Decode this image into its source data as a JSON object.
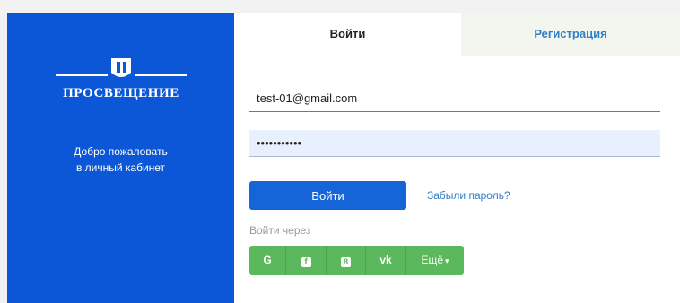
{
  "brand": {
    "name": "ПРОСВЕЩЕНИЕ",
    "accent": "#0b57d8"
  },
  "welcome": {
    "line1": "Добро пожаловать",
    "line2": "в личный кабинет"
  },
  "tabs": [
    {
      "label": "Войти",
      "active": true
    },
    {
      "label": "Регистрация",
      "active": false
    }
  ],
  "form": {
    "email_value": "test-01@gmail.com",
    "password_value": "•••••••••••",
    "login_button": "Войти",
    "forgot_link": "Забыли пароль?",
    "login_via": "Войти через"
  },
  "social": {
    "google": "G",
    "facebook": "f",
    "odnoklassniki": "8",
    "vk": "vk",
    "more_label": "Ещё",
    "more_caret": "▾",
    "color": "#5cb85c"
  }
}
